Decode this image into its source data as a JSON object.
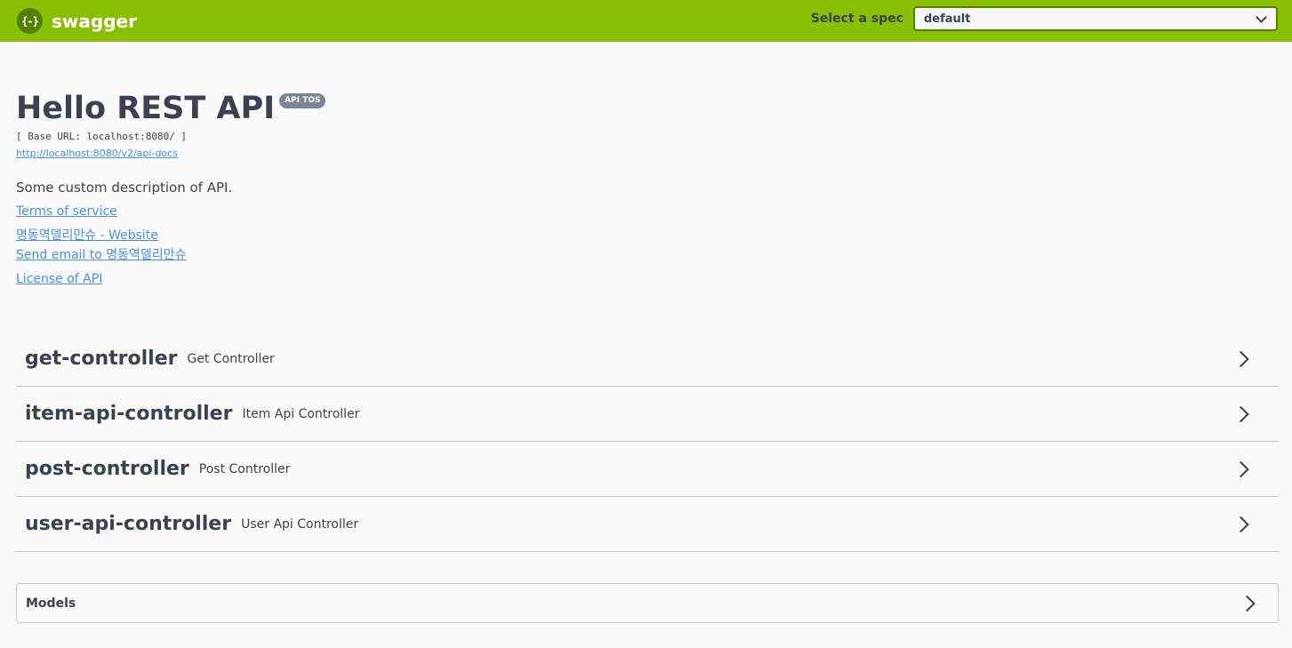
{
  "topbar": {
    "logo_glyph": "{-}",
    "logo_text": "swagger",
    "spec_label": "Select a spec",
    "spec_selected": "default",
    "colors": {
      "background": "#89bf04",
      "logo_circle": "#547f00"
    }
  },
  "info": {
    "title": "Hello REST API",
    "badge": "API TOS",
    "base_url": "[ Base URL: localhost:8080/ ]",
    "spec_url": "http://localhost:8080/v2/api-docs",
    "description": "Some custom description of API.",
    "links": {
      "terms": "Terms of service",
      "website": "명동역델리만슈 - Website",
      "email": "Send email to 명동역델리만슈",
      "license": "License of API"
    },
    "link_color": "#4990e2"
  },
  "tags": [
    {
      "name": "get-controller",
      "description": "Get Controller"
    },
    {
      "name": "item-api-controller",
      "description": "Item Api Controller"
    },
    {
      "name": "post-controller",
      "description": "Post Controller"
    },
    {
      "name": "user-api-controller",
      "description": "User Api Controller"
    }
  ],
  "models": {
    "label": "Models"
  },
  "icons": {
    "logo": "swagger-logo-icon",
    "dropdown": "chevron-down-icon",
    "expand": "chevron-right-icon"
  }
}
